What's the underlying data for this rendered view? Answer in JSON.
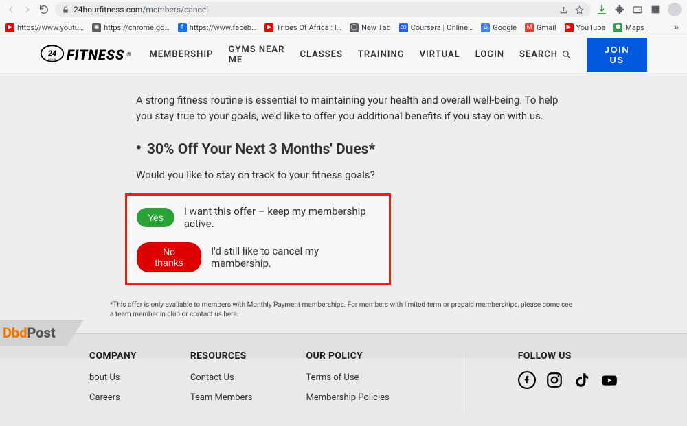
{
  "browser": {
    "url_domain": "24hourfitness.com",
    "url_path": "/members/cancel",
    "share_icon": "share-icon",
    "bookmarks": [
      {
        "label": "https://www.youtu…",
        "color": "#ff0000",
        "glyph": "▶"
      },
      {
        "label": "https://chrome.go…",
        "color": "#5f6368",
        "glyph": "◉"
      },
      {
        "label": "https://www.faceb…",
        "color": "#1877f2",
        "glyph": "f"
      },
      {
        "label": "Tribes Of Africa : I…",
        "color": "#ff0000",
        "glyph": "▶"
      },
      {
        "label": "New Tab",
        "color": "#5f6368",
        "glyph": "◯"
      },
      {
        "label": "Coursera | Online…",
        "color": "#2a63ff",
        "glyph": "∞"
      },
      {
        "label": "Google",
        "color": "#4285f4",
        "glyph": "G"
      },
      {
        "label": "Gmail",
        "color": "#ea4335",
        "glyph": "M"
      },
      {
        "label": "YouTube",
        "color": "#ff0000",
        "glyph": "▶"
      },
      {
        "label": "Maps",
        "color": "#34a853",
        "glyph": "⬢"
      }
    ]
  },
  "header": {
    "logo_text": "FITNESS",
    "logo_caption": "24 HOUR",
    "nav": {
      "membership": "MEMBERSHIP",
      "gyms": "GYMS NEAR ME",
      "classes": "CLASSES",
      "training": "TRAINING",
      "virtual": "VIRTUAL",
      "login": "LOGIN",
      "search": "SEARCH"
    },
    "join": "JOIN US"
  },
  "page": {
    "intro": "A strong fitness routine is essential to maintaining your health and overall well-being. To help you stay true to your goals, we'd like to offer you additional benefits if you stay on with us.",
    "offer_heading": "30% Off Your Next 3 Months' Dues*",
    "prompt": "Would you like to stay on track to your fitness goals?",
    "yes_label": "Yes",
    "yes_text": "I want this offer – keep my membership active.",
    "no_label": "No thanks",
    "no_text": "I'd still like to cancel my membership.",
    "disclaimer": "*This offer is only available to members with Monthly Payment memberships. For members with limited-term or prepaid memberships, please come see a team member in club or contact us here."
  },
  "footer": {
    "company": {
      "title": "COMPANY",
      "links": [
        "bout Us",
        "Careers"
      ]
    },
    "resources": {
      "title": "RESOURCES",
      "links": [
        "Contact Us",
        "Team Members"
      ]
    },
    "policy": {
      "title": "OUR POLICY",
      "links": [
        "Terms of Use",
        "Membership Policies"
      ]
    },
    "follow": {
      "title": "FOLLOW US"
    }
  },
  "watermark": {
    "a": "Dbd",
    "b": "Post"
  }
}
